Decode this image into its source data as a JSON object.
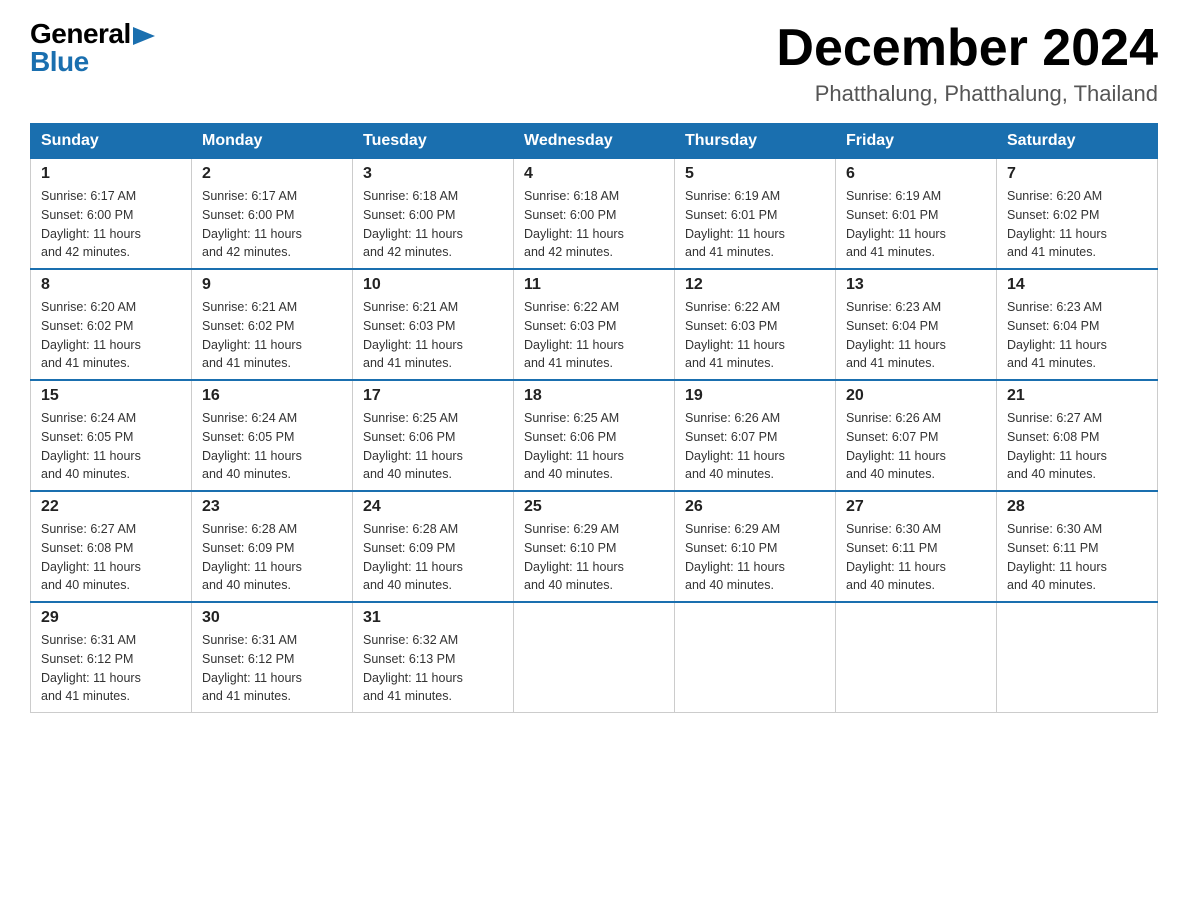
{
  "logo": {
    "general": "General",
    "blue": "Blue",
    "triangle": "▶"
  },
  "title": "December 2024",
  "subtitle": "Phatthalung, Phatthalung, Thailand",
  "days_of_week": [
    "Sunday",
    "Monday",
    "Tuesday",
    "Wednesday",
    "Thursday",
    "Friday",
    "Saturday"
  ],
  "weeks": [
    [
      {
        "day": "1",
        "sunrise": "6:17 AM",
        "sunset": "6:00 PM",
        "daylight": "11 hours and 42 minutes."
      },
      {
        "day": "2",
        "sunrise": "6:17 AM",
        "sunset": "6:00 PM",
        "daylight": "11 hours and 42 minutes."
      },
      {
        "day": "3",
        "sunrise": "6:18 AM",
        "sunset": "6:00 PM",
        "daylight": "11 hours and 42 minutes."
      },
      {
        "day": "4",
        "sunrise": "6:18 AM",
        "sunset": "6:00 PM",
        "daylight": "11 hours and 42 minutes."
      },
      {
        "day": "5",
        "sunrise": "6:19 AM",
        "sunset": "6:01 PM",
        "daylight": "11 hours and 41 minutes."
      },
      {
        "day": "6",
        "sunrise": "6:19 AM",
        "sunset": "6:01 PM",
        "daylight": "11 hours and 41 minutes."
      },
      {
        "day": "7",
        "sunrise": "6:20 AM",
        "sunset": "6:02 PM",
        "daylight": "11 hours and 41 minutes."
      }
    ],
    [
      {
        "day": "8",
        "sunrise": "6:20 AM",
        "sunset": "6:02 PM",
        "daylight": "11 hours and 41 minutes."
      },
      {
        "day": "9",
        "sunrise": "6:21 AM",
        "sunset": "6:02 PM",
        "daylight": "11 hours and 41 minutes."
      },
      {
        "day": "10",
        "sunrise": "6:21 AM",
        "sunset": "6:03 PM",
        "daylight": "11 hours and 41 minutes."
      },
      {
        "day": "11",
        "sunrise": "6:22 AM",
        "sunset": "6:03 PM",
        "daylight": "11 hours and 41 minutes."
      },
      {
        "day": "12",
        "sunrise": "6:22 AM",
        "sunset": "6:03 PM",
        "daylight": "11 hours and 41 minutes."
      },
      {
        "day": "13",
        "sunrise": "6:23 AM",
        "sunset": "6:04 PM",
        "daylight": "11 hours and 41 minutes."
      },
      {
        "day": "14",
        "sunrise": "6:23 AM",
        "sunset": "6:04 PM",
        "daylight": "11 hours and 41 minutes."
      }
    ],
    [
      {
        "day": "15",
        "sunrise": "6:24 AM",
        "sunset": "6:05 PM",
        "daylight": "11 hours and 40 minutes."
      },
      {
        "day": "16",
        "sunrise": "6:24 AM",
        "sunset": "6:05 PM",
        "daylight": "11 hours and 40 minutes."
      },
      {
        "day": "17",
        "sunrise": "6:25 AM",
        "sunset": "6:06 PM",
        "daylight": "11 hours and 40 minutes."
      },
      {
        "day": "18",
        "sunrise": "6:25 AM",
        "sunset": "6:06 PM",
        "daylight": "11 hours and 40 minutes."
      },
      {
        "day": "19",
        "sunrise": "6:26 AM",
        "sunset": "6:07 PM",
        "daylight": "11 hours and 40 minutes."
      },
      {
        "day": "20",
        "sunrise": "6:26 AM",
        "sunset": "6:07 PM",
        "daylight": "11 hours and 40 minutes."
      },
      {
        "day": "21",
        "sunrise": "6:27 AM",
        "sunset": "6:08 PM",
        "daylight": "11 hours and 40 minutes."
      }
    ],
    [
      {
        "day": "22",
        "sunrise": "6:27 AM",
        "sunset": "6:08 PM",
        "daylight": "11 hours and 40 minutes."
      },
      {
        "day": "23",
        "sunrise": "6:28 AM",
        "sunset": "6:09 PM",
        "daylight": "11 hours and 40 minutes."
      },
      {
        "day": "24",
        "sunrise": "6:28 AM",
        "sunset": "6:09 PM",
        "daylight": "11 hours and 40 minutes."
      },
      {
        "day": "25",
        "sunrise": "6:29 AM",
        "sunset": "6:10 PM",
        "daylight": "11 hours and 40 minutes."
      },
      {
        "day": "26",
        "sunrise": "6:29 AM",
        "sunset": "6:10 PM",
        "daylight": "11 hours and 40 minutes."
      },
      {
        "day": "27",
        "sunrise": "6:30 AM",
        "sunset": "6:11 PM",
        "daylight": "11 hours and 40 minutes."
      },
      {
        "day": "28",
        "sunrise": "6:30 AM",
        "sunset": "6:11 PM",
        "daylight": "11 hours and 40 minutes."
      }
    ],
    [
      {
        "day": "29",
        "sunrise": "6:31 AM",
        "sunset": "6:12 PM",
        "daylight": "11 hours and 41 minutes."
      },
      {
        "day": "30",
        "sunrise": "6:31 AM",
        "sunset": "6:12 PM",
        "daylight": "11 hours and 41 minutes."
      },
      {
        "day": "31",
        "sunrise": "6:32 AM",
        "sunset": "6:13 PM",
        "daylight": "11 hours and 41 minutes."
      },
      null,
      null,
      null,
      null
    ]
  ],
  "labels": {
    "sunrise": "Sunrise:",
    "sunset": "Sunset:",
    "daylight": "Daylight:"
  }
}
